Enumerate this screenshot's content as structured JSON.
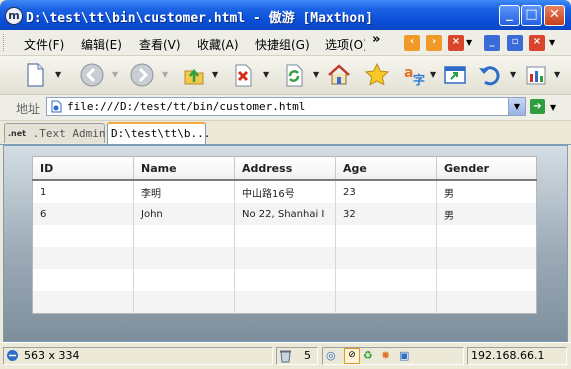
{
  "window": {
    "title": "D:\\test\\tt\\bin\\customer.html - 傲游 [Maxthon]",
    "controls": [
      "minimize",
      "maximize",
      "close"
    ]
  },
  "menu": {
    "items": [
      "文件(F)",
      "编辑(E)",
      "查看(V)",
      "收藏(A)",
      "快捷组(G)",
      "选项(O)"
    ],
    "more": "»"
  },
  "toolbar": {
    "buttons": [
      "new-page",
      "back",
      "forward",
      "up",
      "stop",
      "refresh",
      "home",
      "favorites",
      "translate",
      "open-link",
      "undo-close",
      "tools"
    ]
  },
  "address": {
    "label": "地址",
    "url": "file:///D:/test/tt/bin/customer.html"
  },
  "tabs": [
    {
      "icon": ".net",
      "label": ".Text Admin"
    },
    {
      "label": "D:\\test\\tt\\b..."
    }
  ],
  "grid": {
    "columns": [
      "ID",
      "Name",
      "Address",
      "Age",
      "Gender"
    ],
    "rows": [
      [
        "1",
        "李明",
        "中山路16号",
        "23",
        "男"
      ],
      [
        "6",
        "John",
        "No 22, Shanhai I",
        "32",
        "男"
      ],
      [
        "",
        "",
        "",
        "",
        ""
      ],
      [
        "",
        "",
        "",
        "",
        ""
      ],
      [
        "",
        "",
        "",
        "",
        ""
      ],
      [
        "",
        "",
        "",
        "",
        ""
      ]
    ]
  },
  "status": {
    "dimensions": "563 x 334",
    "count": "5",
    "ip": "192.168.66.1"
  }
}
